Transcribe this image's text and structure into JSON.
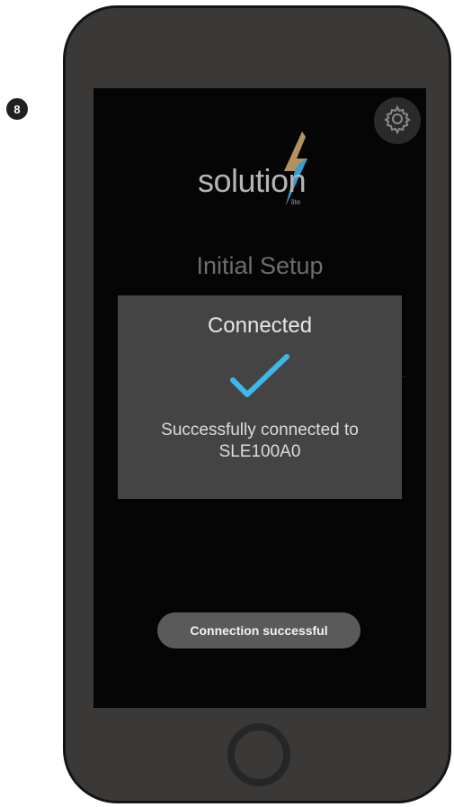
{
  "step": {
    "number": "8"
  },
  "app": {
    "logo_text": "solution",
    "logo_subtext": "lite",
    "background_title": "Initial Setup",
    "accent_color": "#3db8e8"
  },
  "icons": {
    "settings": "gear-icon",
    "success": "checkmark-icon"
  },
  "dialog": {
    "title": "Connected",
    "message": "Successfully connected to SLE100A0"
  },
  "toast": {
    "text": "Connection successful"
  }
}
